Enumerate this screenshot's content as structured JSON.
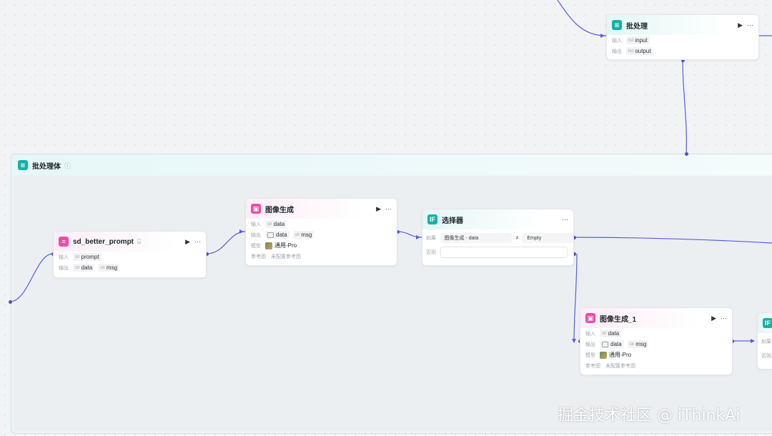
{
  "group": {
    "title": "批处理体",
    "info_icon": "info-icon"
  },
  "batch_node": {
    "title": "批处理",
    "input_label": "输入",
    "input_value": "input",
    "output_label": "输出",
    "output_value": "output",
    "type_tag": "list"
  },
  "sd_node": {
    "title": "sd_better_prompt",
    "input_label": "输入",
    "input_value": "prompt",
    "output_label": "输出",
    "outputs": [
      "data",
      "msg"
    ],
    "type_tag": "str"
  },
  "img_node": {
    "title": "图像生成",
    "input_label": "输入",
    "input_value": "data",
    "output_label": "输出",
    "outputs": [
      "data",
      "msg"
    ],
    "model_label": "模型",
    "model_value": "通用-Pro",
    "ref_label": "参考图",
    "ref_value": "未配置参考图",
    "type_tag": "str"
  },
  "selector_node": {
    "title": "选择器",
    "cond_label": "如果",
    "cond_left": "图像生成 - data",
    "cond_op": "≠",
    "cond_right": "Empty",
    "else_label": "否则"
  },
  "img_node_1": {
    "title": "图像生成_1",
    "input_label": "输入",
    "input_value": "data",
    "output_label": "输出",
    "outputs": [
      "data",
      "msg"
    ],
    "model_label": "模型",
    "model_value": "通用-Pro",
    "ref_label": "参考图",
    "ref_value": "未配置参考图",
    "type_tag": "str"
  },
  "partial_node": {
    "cond_label": "如果",
    "else_label": "否则"
  },
  "icons": {
    "run": "▶",
    "more": "···",
    "if": "IF"
  },
  "watermark": "掘金技术社区 @ iThinkAi",
  "colors": {
    "wire": "#5a5de0",
    "accent_teal": "#14b2a5",
    "accent_pink": "#e94fa7"
  }
}
